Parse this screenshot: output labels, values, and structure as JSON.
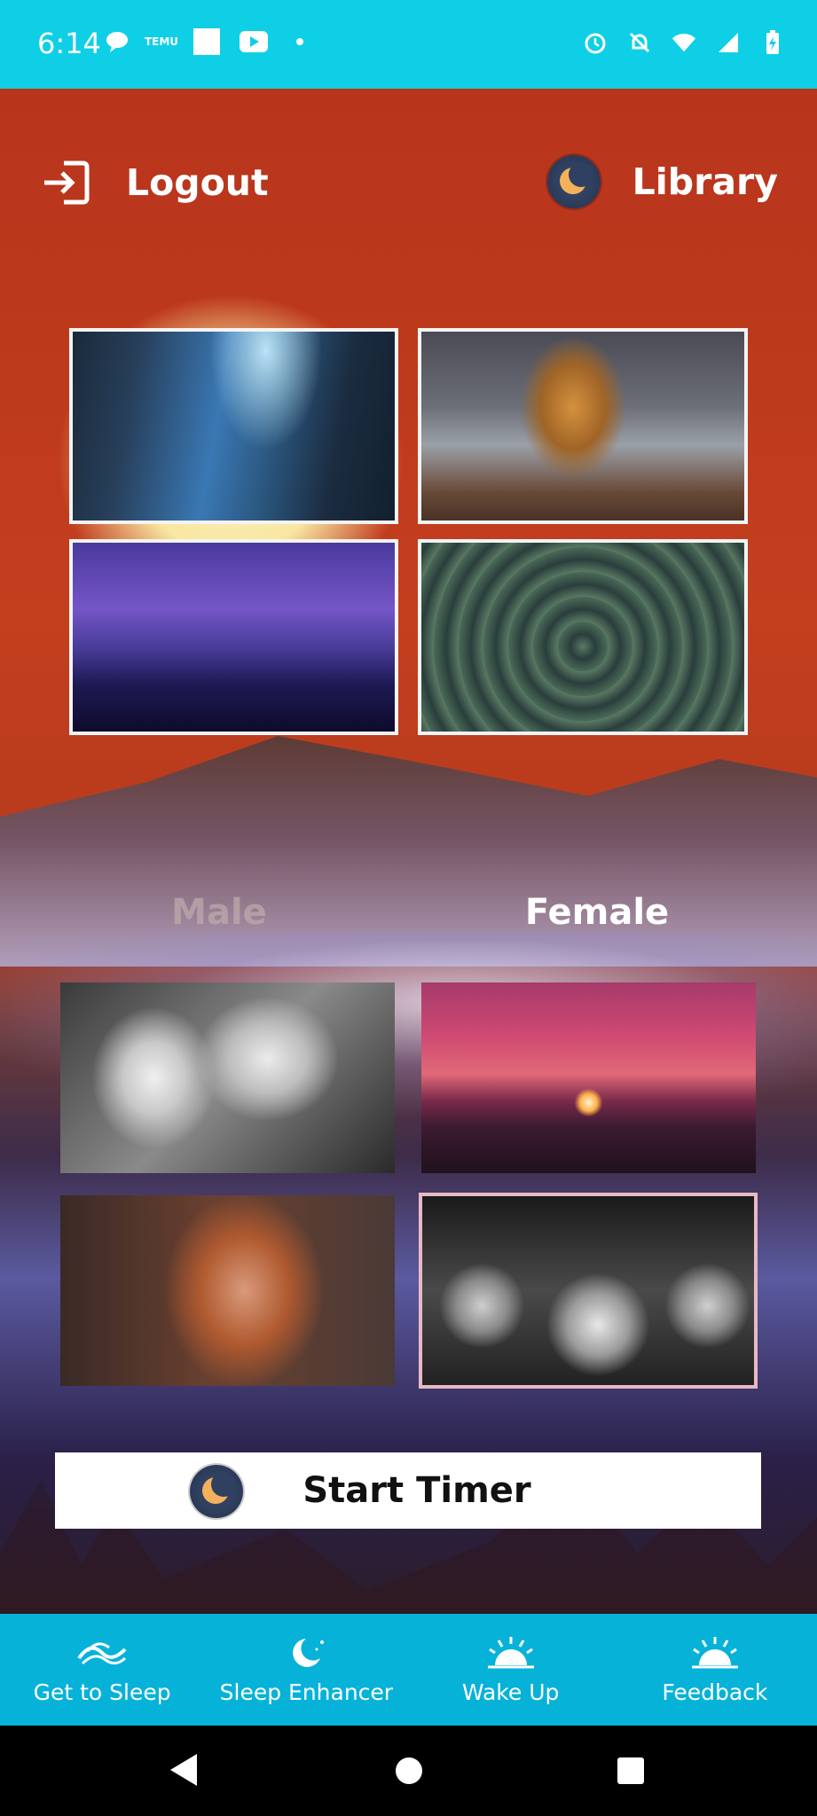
{
  "status_bar": {
    "time": "6:14",
    "left_icons": [
      "chat-icon",
      "temu-icon",
      "square-icon",
      "youtube-icon",
      "dot-icon"
    ],
    "right_icons": [
      "alarm-icon",
      "bell-off-icon",
      "wifi-icon",
      "signal-icon",
      "battery-charging-icon"
    ],
    "temu_text": "TEMU"
  },
  "header": {
    "logout_label": "Logout",
    "library_label": "Library"
  },
  "scenes": [
    {
      "name": "underwater-cave-image"
    },
    {
      "name": "ship-storm-image"
    },
    {
      "name": "lightning-mountains-image"
    },
    {
      "name": "green-spiral-image"
    }
  ],
  "voice_tabs": {
    "male": "Male",
    "female": "Female",
    "selected": "Female"
  },
  "voices": [
    {
      "name": "skull-child-image"
    },
    {
      "name": "sunset-tree-image"
    },
    {
      "name": "laughing-woman-image"
    },
    {
      "name": "pocket-watches-image",
      "selected": true
    }
  ],
  "start_timer": {
    "label": "Start Timer"
  },
  "bottom_nav": {
    "items": [
      {
        "label": "Get to Sleep",
        "icon": "waves-icon"
      },
      {
        "label": "Sleep Enhancer",
        "icon": "moon-stars-icon"
      },
      {
        "label": "Wake Up",
        "icon": "sunrise-icon"
      },
      {
        "label": "Feedback",
        "icon": "sunrise-icon"
      }
    ]
  },
  "colors": {
    "status_bar": "#0fcfe6",
    "bottom_nav": "#07b2d9",
    "start_timer_bg": "#ffffff"
  }
}
